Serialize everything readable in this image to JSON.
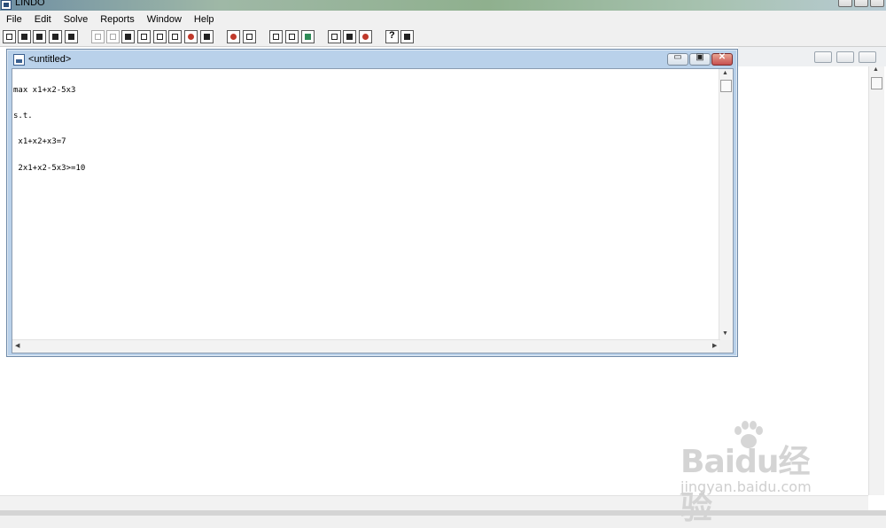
{
  "app": {
    "title": "LINDO"
  },
  "menu": [
    "File",
    "Edit",
    "Solve",
    "Reports",
    "Window",
    "Help"
  ],
  "toolbar": {
    "buttons": [
      "new-file",
      "open-file",
      "view-file",
      "save-file",
      "print",
      "cut",
      "copy",
      "paste",
      "find",
      "clear",
      "goto-line",
      "sigma",
      "traffic-light",
      "solve",
      "compile",
      "zoom-fit",
      "zoom",
      "status",
      "tile",
      "cascade",
      "close-all",
      "help",
      "context-help"
    ]
  },
  "child_window": {
    "title": "<untitled>",
    "minimize_glyph": "▭",
    "restore_glyph": "▣",
    "close_glyph": "✕",
    "model_lines": [
      "max x1+x2-5x3",
      "s.t.",
      " x1+x2+x3=7",
      " 2x1+x2-5x3>=10"
    ]
  },
  "watermark": {
    "logo_text": "Baidu经验",
    "url": "jingyan.baidu.com"
  }
}
